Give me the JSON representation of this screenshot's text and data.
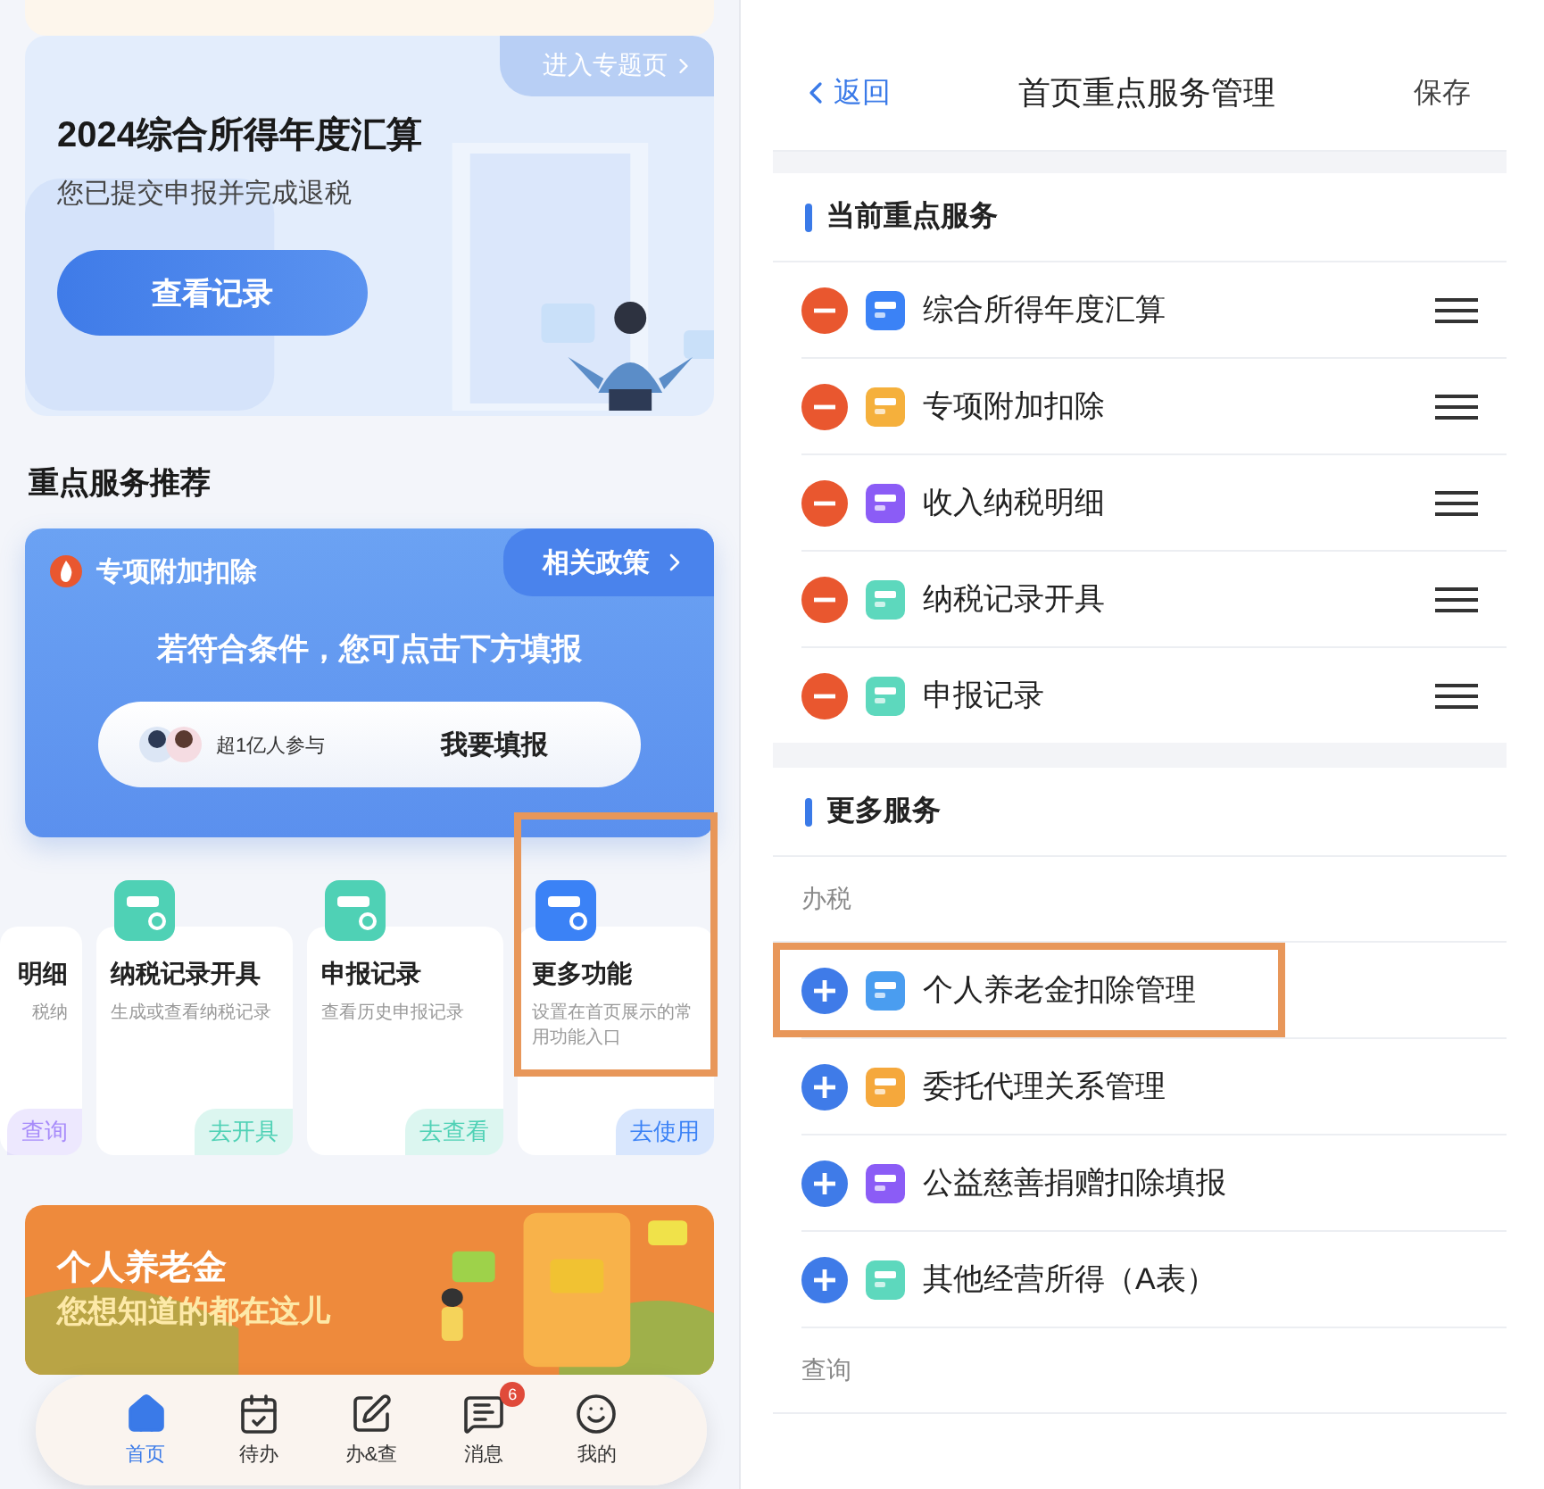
{
  "home": {
    "hero": {
      "link": "进入专题页",
      "title": "2024综合所得年度汇算",
      "subtitle": "您已提交申报并完成退税",
      "button": "查看记录"
    },
    "section_title": "重点服务推荐",
    "promo": {
      "title": "专项附加扣除",
      "link": "相关政策",
      "message": "若符合条件，您可点击下方填报",
      "participants": "超1亿人参与",
      "button": "我要填报"
    },
    "service_cards": [
      {
        "title": "明细",
        "desc": "税纳",
        "action": "查询",
        "color": "#a78bfa",
        "highlighted": false
      },
      {
        "title": "纳税记录开具",
        "desc": "生成或查看纳税记录",
        "action": "去开具",
        "color": "#4fd1b5",
        "highlighted": false
      },
      {
        "title": "申报记录",
        "desc": "查看历史申报记录",
        "action": "去查看",
        "color": "#4fd1b5",
        "highlighted": false
      },
      {
        "title": "更多功能",
        "desc": "设置在首页展示的常用功能入口",
        "action": "去使用",
        "color": "#3b82f6",
        "highlighted": true
      }
    ],
    "banner": {
      "title": "个人养老金",
      "subtitle": "您想知道的都在这儿"
    },
    "nav": [
      {
        "label": "首页",
        "selected": true
      },
      {
        "label": "待办",
        "selected": false
      },
      {
        "label": "办&查",
        "selected": false
      },
      {
        "label": "消息",
        "selected": false,
        "badge": "6"
      },
      {
        "label": "我的",
        "selected": false
      }
    ]
  },
  "manage": {
    "back": "返回",
    "title": "首页重点服务管理",
    "save": "保存",
    "current": {
      "title": "当前重点服务",
      "items": [
        {
          "name": "综合所得年度汇算",
          "color": "#3b82f6"
        },
        {
          "name": "专项附加扣除",
          "color": "#f5b03c"
        },
        {
          "name": "收入纳税明细",
          "color": "#8b5cf6"
        },
        {
          "name": "纳税记录开具",
          "color": "#5dd8bd"
        },
        {
          "name": "申报记录",
          "color": "#5dd8bd"
        }
      ]
    },
    "more": {
      "title": "更多服务",
      "groups": [
        {
          "label": "办税",
          "items": [
            {
              "name": "个人养老金扣除管理",
              "color": "#4a9df0",
              "highlighted": true
            },
            {
              "name": "委托代理关系管理",
              "color": "#f5a83c",
              "highlighted": false
            },
            {
              "name": "公益慈善捐赠扣除填报",
              "color": "#8b5cf6",
              "highlighted": false
            },
            {
              "name": "其他经营所得（A表）",
              "color": "#5dd8bd",
              "highlighted": false
            }
          ]
        },
        {
          "label": "查询"
        }
      ]
    }
  }
}
